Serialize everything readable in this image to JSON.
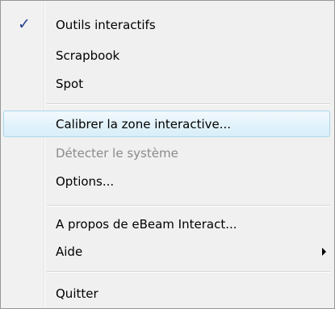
{
  "menu": {
    "items": [
      {
        "label": "Outils interactifs",
        "checked": true
      },
      {
        "label": "Scrapbook"
      },
      {
        "label": "Spot"
      },
      {
        "label": "Calibrer la zone interactive...",
        "highlighted": true
      },
      {
        "label": "Détecter le système",
        "disabled": true
      },
      {
        "label": "Options..."
      },
      {
        "label": "A propos de eBeam Interact..."
      },
      {
        "label": "Aide",
        "has_submenu": true
      },
      {
        "label": "Quitter"
      }
    ],
    "check_glyph": "✓",
    "colors": {
      "highlight_border": "#a8d8eb",
      "disabled_text": "#8a8a8a",
      "check": "#1f3f8f"
    }
  }
}
